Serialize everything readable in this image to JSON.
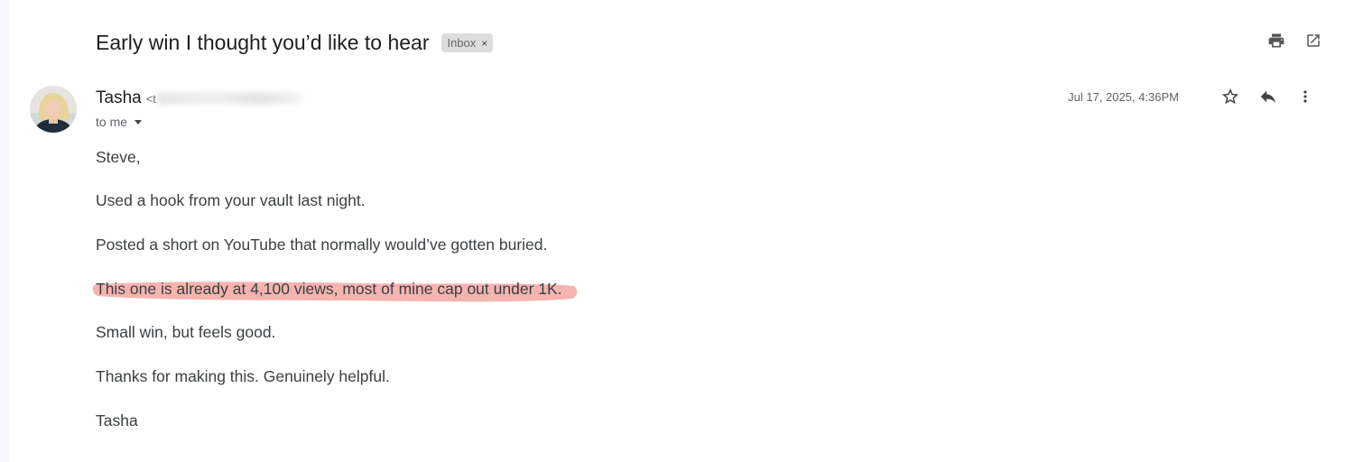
{
  "email": {
    "subject": "Early win I thought you’d like to hear",
    "label": "Inbox",
    "label_close": "×",
    "sender_name": "Tasha",
    "sender_email_prefix": "<t",
    "recipient_text": "to me",
    "date": "Jul 17, 2025, 4:36PM"
  },
  "body": {
    "lines": [
      "Steve,",
      "Used a hook from your vault last night.",
      "Posted a short on YouTube that normally would’ve gotten buried.",
      "This one is already at 4,100 views, most of mine cap out under 1K.",
      "Small win, but feels good.",
      "Thanks for making this. Genuinely helpful.",
      "Tasha"
    ]
  },
  "icons": {
    "print": "print-icon",
    "open_new_window": "open-in-new-window-icon",
    "star": "star-icon",
    "reply": "reply-icon",
    "more": "more-options-icon",
    "caret": "chevron-down-icon"
  },
  "colors": {
    "highlight": "#f3a7a2",
    "label_bg": "#dddddd",
    "text": "#3c4043"
  }
}
